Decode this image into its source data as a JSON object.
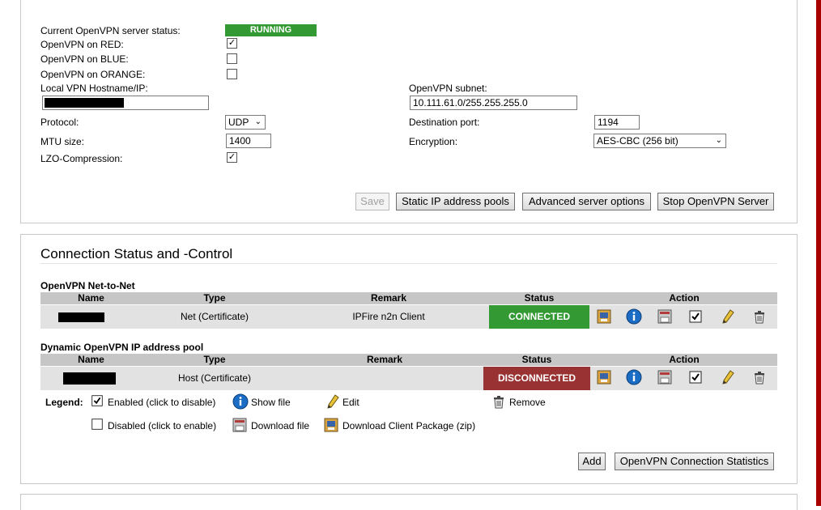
{
  "server": {
    "status_label": "Current OpenVPN server status:",
    "status_value": "RUNNING",
    "red_label": "OpenVPN on RED:",
    "red_checked": true,
    "blue_label": "OpenVPN on BLUE:",
    "blue_checked": false,
    "orange_label": "OpenVPN on ORANGE:",
    "orange_checked": false,
    "hostname_label": "Local VPN Hostname/IP:",
    "hostname_value": "",
    "subnet_label": "OpenVPN subnet:",
    "subnet_value": "10.111.61.0/255.255.255.0",
    "protocol_label": "Protocol:",
    "protocol_value": "UDP",
    "dest_port_label": "Destination port:",
    "dest_port_value": "1194",
    "mtu_label": "MTU size:",
    "mtu_value": "1400",
    "encryption_label": "Encryption:",
    "encryption_value": "AES-CBC (256 bit)",
    "lzo_label": "LZO-Compression:",
    "lzo_checked": true,
    "buttons": {
      "save": "Save",
      "static_ip": "Static IP address pools",
      "advanced": "Advanced server options",
      "stop": "Stop OpenVPN Server"
    }
  },
  "connections": {
    "title": "Connection Status and -Control",
    "net2net": {
      "heading": "OpenVPN Net-to-Net",
      "columns": [
        "Name",
        "Type",
        "Remark",
        "Status",
        "Action"
      ],
      "rows": [
        {
          "name": "",
          "type": "Net (Certificate)",
          "remark": "IPFire n2n Client",
          "status": "CONNECTED"
        }
      ]
    },
    "dynamic": {
      "heading": "Dynamic OpenVPN IP address pool",
      "columns": [
        "Name",
        "Type",
        "Remark",
        "Status",
        "Action"
      ],
      "rows": [
        {
          "name": "",
          "type": "Host (Certificate)",
          "remark": "",
          "status": "DISCONNECTED"
        }
      ]
    },
    "legend": {
      "title": "Legend:",
      "enabled": "Enabled (click to disable)",
      "show_file": "Show file",
      "edit": "Edit",
      "remove": "Remove",
      "disabled": "Disabled (click to enable)",
      "download_file": "Download file",
      "download_client": "Download Client Package (zip)"
    },
    "buttons": {
      "add": "Add",
      "statistics": "OpenVPN Connection Statistics"
    }
  },
  "colors": {
    "running": "#339933",
    "connected": "#339933",
    "disconnected": "#993333",
    "accent_bar": "#a90000"
  }
}
